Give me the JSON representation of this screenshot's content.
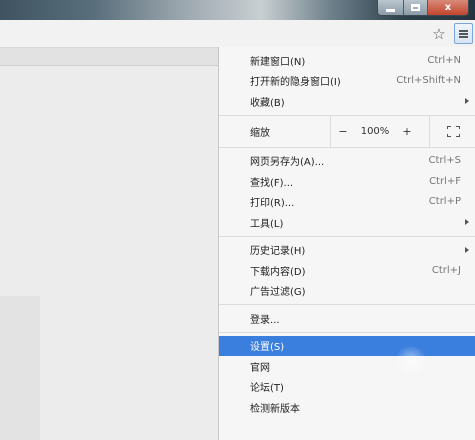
{
  "window": {
    "controls": [
      "minimize",
      "maximize",
      "close"
    ],
    "close_glyph": "x"
  },
  "toolbar": {
    "bookmark_icon": "star-icon",
    "menu_icon": "hamburger-icon"
  },
  "menu": {
    "group1": [
      {
        "label": "新建窗口(N)",
        "shortcut": "Ctrl+N"
      },
      {
        "label": "打开新的隐身窗口(I)",
        "shortcut": "Ctrl+Shift+N"
      },
      {
        "label": "收藏(B)",
        "shortcut": "",
        "submenu": true
      }
    ],
    "zoom": {
      "label": "缩放",
      "minus": "−",
      "value": "100%",
      "plus": "+"
    },
    "group2": [
      {
        "label": "网页另存为(A)...",
        "shortcut": "Ctrl+S"
      },
      {
        "label": "查找(F)...",
        "shortcut": "Ctrl+F"
      },
      {
        "label": "打印(R)...",
        "shortcut": "Ctrl+P"
      },
      {
        "label": "工具(L)",
        "shortcut": "",
        "submenu": true
      }
    ],
    "group3": [
      {
        "label": "历史记录(H)",
        "shortcut": "",
        "submenu": true
      },
      {
        "label": "下载内容(D)",
        "shortcut": "Ctrl+J"
      },
      {
        "label": "广告过滤(G)",
        "shortcut": ""
      }
    ],
    "group4": [
      {
        "label": "登录...",
        "shortcut": ""
      }
    ],
    "group5": [
      {
        "label": "设置(S)",
        "shortcut": "",
        "highlighted": true
      },
      {
        "label": "官网",
        "shortcut": ""
      },
      {
        "label": "论坛(T)",
        "shortcut": ""
      },
      {
        "label": "检测新版本",
        "shortcut": ""
      }
    ]
  },
  "colors": {
    "highlight": "#3a7ede",
    "menu_bg": "#f6f6f6"
  }
}
